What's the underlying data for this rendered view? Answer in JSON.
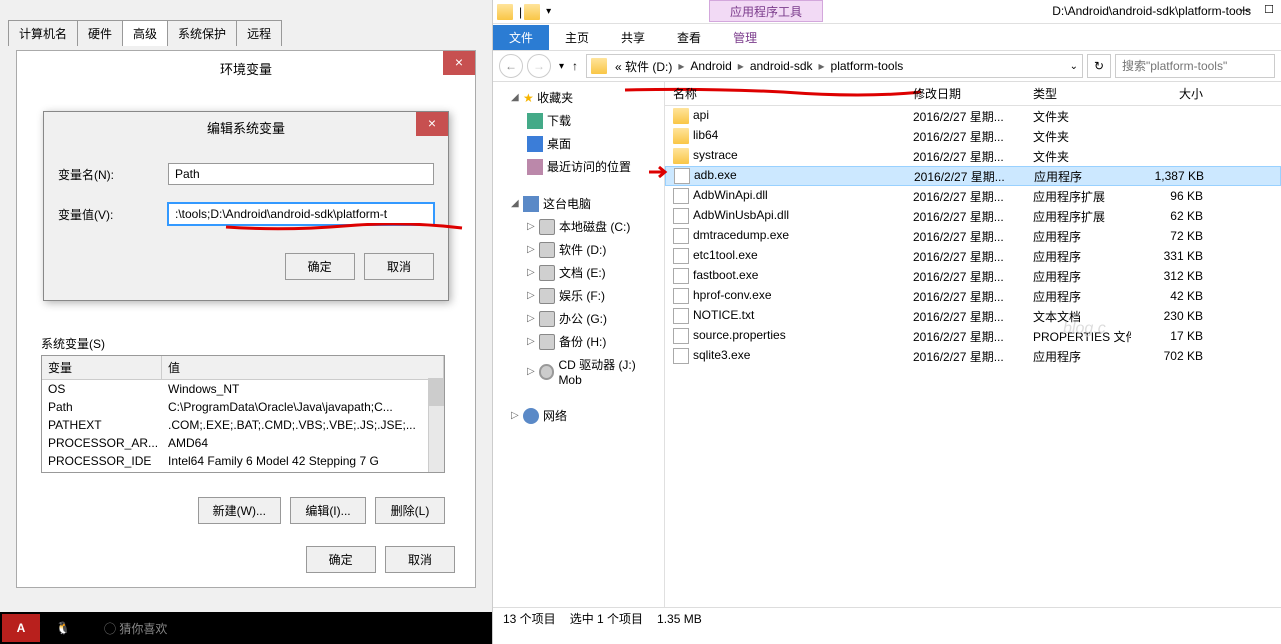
{
  "sysTabs": [
    "计算机名",
    "硬件",
    "高级",
    "系统保护",
    "远程"
  ],
  "envDialog": {
    "title": "环境变量"
  },
  "editDialog": {
    "title": "编辑系统变量",
    "nameLabel": "变量名(N):",
    "valueLabel": "变量值(V):",
    "nameValue": "Path",
    "valueValue": ":\\tools;D:\\Android\\android-sdk\\platform-t",
    "ok": "确定",
    "cancel": "取消"
  },
  "sysVar": {
    "label": "系统变量(S)",
    "head": {
      "c1": "变量",
      "c2": "值"
    },
    "rows": [
      {
        "c1": "OS",
        "c2": "Windows_NT"
      },
      {
        "c1": "Path",
        "c2": "C:\\ProgramData\\Oracle\\Java\\javapath;C..."
      },
      {
        "c1": "PATHEXT",
        "c2": ".COM;.EXE;.BAT;.CMD;.VBS;.VBE;.JS;.JSE;..."
      },
      {
        "c1": "PROCESSOR_AR...",
        "c2": "AMD64"
      },
      {
        "c1": "PROCESSOR_IDE",
        "c2": "Intel64 Family 6 Model 42 Stepping 7 G"
      }
    ],
    "new": "新建(W)...",
    "edit": "编辑(I)...",
    "del": "删除(L)"
  },
  "envBtns": {
    "ok": "确定",
    "cancel": "取消"
  },
  "taskbar": {
    "like": "猜你喜欢"
  },
  "explorer": {
    "appTools": "应用程序工具",
    "titlePath": "D:\\Android\\android-sdk\\platform-tools",
    "ribbon": {
      "file": "文件",
      "home": "主页",
      "share": "共享",
      "view": "查看",
      "manage": "管理"
    },
    "crumbs": [
      "« 软件 (D:)",
      "Android",
      "android-sdk",
      "platform-tools"
    ],
    "searchPlaceholder": "搜索\"platform-tools\"",
    "headers": {
      "name": "名称",
      "date": "修改日期",
      "type": "类型",
      "size": "大小"
    },
    "tree": {
      "fav": "收藏夹",
      "dl": "下载",
      "desk": "桌面",
      "recent": "最近访问的位置",
      "pc": "这台电脑",
      "c": "本地磁盘 (C:)",
      "d": "软件 (D:)",
      "e": "文档 (E:)",
      "f": "娱乐 (F:)",
      "g": "办公 (G:)",
      "h": "备份 (H:)",
      "j": "CD 驱动器 (J:) Mob",
      "net": "网络"
    },
    "files": [
      {
        "name": "api",
        "date": "2016/2/27 星期...",
        "type": "文件夹",
        "size": "",
        "ico": "folder"
      },
      {
        "name": "lib64",
        "date": "2016/2/27 星期...",
        "type": "文件夹",
        "size": "",
        "ico": "folder"
      },
      {
        "name": "systrace",
        "date": "2016/2/27 星期...",
        "type": "文件夹",
        "size": "",
        "ico": "folder"
      },
      {
        "name": "adb.exe",
        "date": "2016/2/27 星期...",
        "type": "应用程序",
        "size": "1,387 KB",
        "ico": "file",
        "sel": true
      },
      {
        "name": "AdbWinApi.dll",
        "date": "2016/2/27 星期...",
        "type": "应用程序扩展",
        "size": "96 KB",
        "ico": "file"
      },
      {
        "name": "AdbWinUsbApi.dll",
        "date": "2016/2/27 星期...",
        "type": "应用程序扩展",
        "size": "62 KB",
        "ico": "file"
      },
      {
        "name": "dmtracedump.exe",
        "date": "2016/2/27 星期...",
        "type": "应用程序",
        "size": "72 KB",
        "ico": "file"
      },
      {
        "name": "etc1tool.exe",
        "date": "2016/2/27 星期...",
        "type": "应用程序",
        "size": "331 KB",
        "ico": "file"
      },
      {
        "name": "fastboot.exe",
        "date": "2016/2/27 星期...",
        "type": "应用程序",
        "size": "312 KB",
        "ico": "file"
      },
      {
        "name": "hprof-conv.exe",
        "date": "2016/2/27 星期...",
        "type": "应用程序",
        "size": "42 KB",
        "ico": "file"
      },
      {
        "name": "NOTICE.txt",
        "date": "2016/2/27 星期...",
        "type": "文本文档",
        "size": "230 KB",
        "ico": "file"
      },
      {
        "name": "source.properties",
        "date": "2016/2/27 星期...",
        "type": "PROPERTIES 文件",
        "size": "17 KB",
        "ico": "file"
      },
      {
        "name": "sqlite3.exe",
        "date": "2016/2/27 星期...",
        "type": "应用程序",
        "size": "702 KB",
        "ico": "file"
      }
    ],
    "status": {
      "count": "13 个项目",
      "sel": "选中 1 个项目",
      "size": "1.35 MB"
    }
  }
}
